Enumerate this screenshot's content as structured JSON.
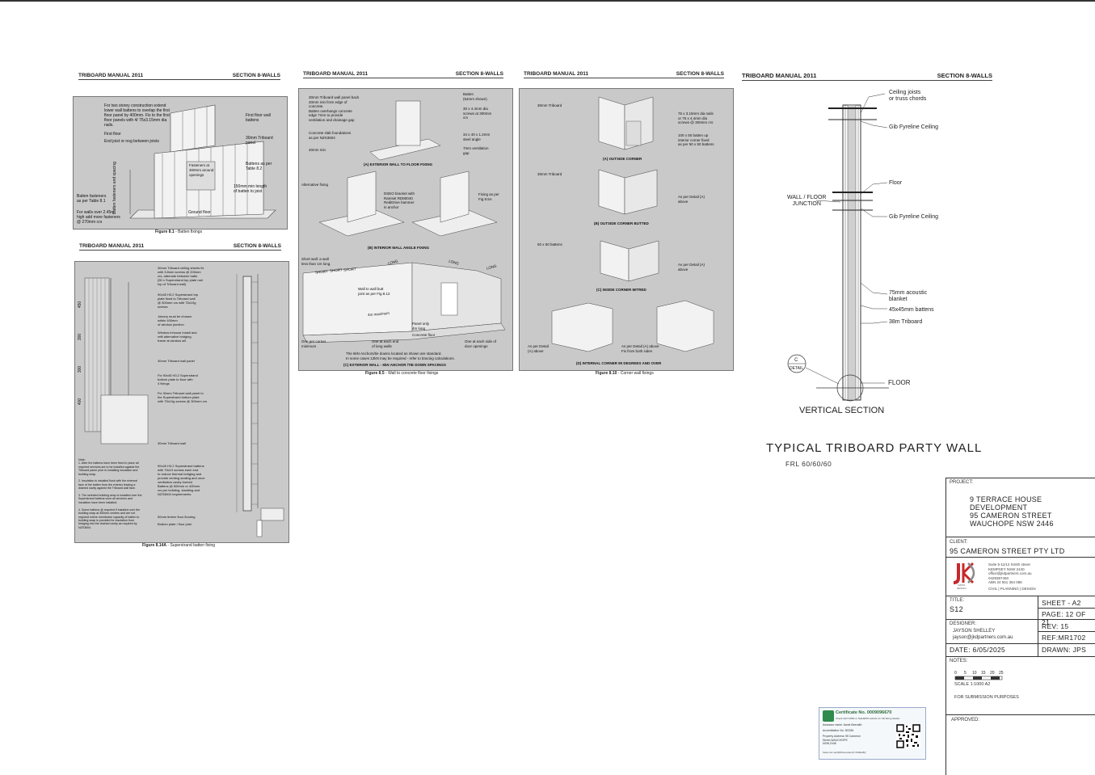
{
  "manual": {
    "header_left": "TRIBOARD MANUAL 2011",
    "header_right": "SECTION 8-WALLS"
  },
  "fig81": {
    "labels": [
      "For two storey construction extend\nlower wall battens to overlap the first\nfloor panel by 400mm. Fix to the first\nfloor panels with 4/ 75x3.15mm dia\nnails.",
      "First floor",
      "End joist or nog between joists",
      "First floor wall\nbattens",
      "30mm Triboard\npanel",
      "Battens as per\nTable 8.2",
      "150mm min length\nof batten to joist",
      "Batten fasteners\nas per Table 8.1",
      "For walls over 2.45m\nhigh add more fasteners\n@ 270mm crs",
      "Ground floor",
      "Fasteners at\n300mm around\nopenings",
      "Batten fasteners and spacing"
    ],
    "caption_bold": "Figure 8.1",
    "caption": " - Batten fixings"
  },
  "fig85": {
    "labels": [
      "30mm Triboard wall panel back\n40mm min from edge of\nconcrete.\nBatten overhangs concrete\nedge 7mm to provide\nventilation and drainage gap",
      "Concrete slab foundations\nas per NZS3604",
      "40mm min",
      "Batten\n(64mm shown)",
      "30 x 4.4mm dia\nscrews at 300mm\ncrs",
      "34 x 40 x 1.2mm\nsteel angle",
      "7mm ventilation\ngap",
      "Alternative fixing",
      "DSEO bracket with\nRamset RD80040\nRediDrive hammer\nin anchor",
      "Fixing as per\nFig 8.5A",
      "Short wall: a wall\nless than 1m long.",
      "Wall to wall butt\njoint as per Fig.8.12",
      "One per corner\nminimum",
      "One at each end\nof long walls",
      "Panel only\n4m long",
      "Concrete floor",
      "One at each side of\ndoor openings",
      "The 6kN Anchors/tie downs located as shown are standard.\nIn some cases 12kN may be required - refer to bracing calculations.",
      "4m maximum"
    ],
    "wall_words": [
      "SHORT",
      "SHORT",
      "SHORT",
      "LONG",
      "LONG",
      "LONG"
    ],
    "subcap_a": "(A) EXTERIOR WALL TO FLOOR FIXING",
    "subcap_b": "(B) INTERIOR WALL ANGLE FIXING",
    "subcap_c": "(C) EXTERIOR WALL - 6kN ANCHOR /TIE DOWN SPACINGS",
    "caption_bold": "Figure 8.5",
    "caption": " - Wall to concrete floor fixings"
  },
  "fig810": {
    "labels": [
      "30mm Triboard",
      "75 x 3.15mm dia nails\nor 75 x 4.4mm dia\nscrews @ 300mm crs",
      "100 x 50 batten up\ninterior corner fixed\nas per 50 x 50 battens",
      "30mm Triboard",
      "As per Detail (A)\nabove",
      "50 x 50 battens",
      "As per Detail (A)\nabove",
      "As per Detail\n(A) above",
      "As per Detail (A) above\nFix from both sides"
    ],
    "subcap_a": "(A) OUTSIDE CORNER",
    "subcap_b": "(B) OUTSIDE CORNER BUTTED",
    "subcap_c": "(C) INSIDE CORNER MITRED",
    "subcap_d": "(D) INTERNAL CORNER 90 DEGREES AND OVER",
    "caption_bold": "Figure 8.10",
    "caption": " - Corner wall fixings"
  },
  "fig814a": {
    "note": "Note:\n1. After the battens have been fixed in place all\nrequired services are to be installed against the\nTriboard panel prior to installing insulation and\nbuilding wrap.\n\n2. Insulation is installed flush with the external\nface of the batten from the exterior leaving a\ndrained cavity against the Triboard wall face.\n\n3. The selected building wrap is installed over the\nSuperstrand battens once all services and\ninsulation have been installed.\n\n4. Some battens @ required if installed over the\nbuilding wrap at 450mm centres and are not\nrequired where membrane capacity of batten to\nbuilding wrap is provided for insulation from\nbridging into the drained cavity as required by\nNZS3604.",
    "right_labels": [
      "30mm Triboard ceiling sheets fix\nwith 3.8mm screws @ 200mm\ncrs, alternate between batts\n(50 x Superstrand top plate nail\ntop of Triboard wall)",
      "90x45 H3.2 Superstrand top\nplate fixed to Triboard wall\n@ 300mm crs with 75x10g\nscrews",
      "Joinery must be chosen\nwithin 400mm\nof window junction",
      "Window inhouse install and\nrefit alternative bridging\nframe at window sill",
      "30mm Triboard wall panel",
      "Fix 90x45 H3.2 Superstrand\nbottom plate to floor with\n4 fixings",
      "Fix 30mm Triboard wall panel to\nthe Superstrand bottom plate\nwith 75x10g screws @ 300mm crs",
      "30mm Triboard wall",
      "90x45 H3.2 Superstrand battens\nwith 75x10 screws each end\nto reduce thermal bridging and\nprovide venting sealing and once\nventilation cavity formed\nBattens @ 600mm or 400mm\ncrs per building, cladding and\nNZS3604 requirements",
      "50mm timber floor flooring",
      "Bottom plate / floor joist"
    ],
    "left_nums": [
      "450",
      "300",
      "300",
      "400"
    ],
    "caption_bold": "Figure 8.14A",
    "caption": " - Superstrand batten fixing"
  },
  "section": {
    "labels": {
      "ceiling_joists": "Ceiling joists\nor truss chords",
      "gib1": "Gib Fyreline Ceiling",
      "floor": "Floor",
      "junction": "WALL / FLOOR\nJUNCTION",
      "gib2": "Gib Fyreline Ceiling",
      "blanket": "75mm acoustic\nblanket",
      "battens": "45x45mm battens",
      "triboard": "38m Triboard",
      "floor2": "FLOOR",
      "detail_letter": "C",
      "detail_word": "DETAIL"
    },
    "vertical_section": "VERTICAL SECTION",
    "title": "TYPICAL TRIBOARD PARTY WALL",
    "frl": "FRL 60/60/60"
  },
  "titleblock": {
    "project_label": "PROJECT:",
    "project": "9 TERRACE HOUSE\nDEVELOPMENT\n95 CAMERON STREET\nWAUCHOPE NSW 2446",
    "client_label": "CLIENT:",
    "client": "95 CAMERON STREET PTY LTD",
    "company_address": "Suite 5-11/12 Smith street\nKEMPSEY NSW 2440\noffice@jkdpartners.com.au\n0429387460\nABN 24 551 354 086",
    "company_services": "CIVIL | PLANNING | DESIGN",
    "logo_sub": "DAVIS\nDESIGN",
    "title_label": "TITLE:",
    "title": "S12",
    "sheet": "SHEET - A2",
    "page": "PAGE: 12 OF 21",
    "designer_label": "DESIGNER:",
    "designer_name": "JAYSON SHELLEY",
    "designer_email": "jayson@jkdpartners.com.au",
    "rev": "REV: 15",
    "ref": "REF:MR1702",
    "date": "DATE: 6/05/2025",
    "drawn": "DRAWN: JPS",
    "notes_label": "NOTES:",
    "scale_ticks": [
      "0",
      "5",
      "10",
      "15",
      "20",
      "25"
    ],
    "scale_text": "SCALE 1:1000 A2",
    "purpose": "FOR SUBMISSION PURPOSES",
    "approved_label": "APPROVED:"
  },
  "certificate": {
    "title": "Certificate No. 0009096670",
    "sub": "Check with NABA or NatHERS website for full listing details.",
    "rows": [
      "Assessor name  Jamie Beeraith",
      "Accreditation No.  NS336",
      "Property Address  95 Cameron\nStreet,WAUCHOPE\nNSW,2446"
    ],
    "footer": "hstar.com.au/QR/Generate?p=Sh9ke8Q"
  }
}
